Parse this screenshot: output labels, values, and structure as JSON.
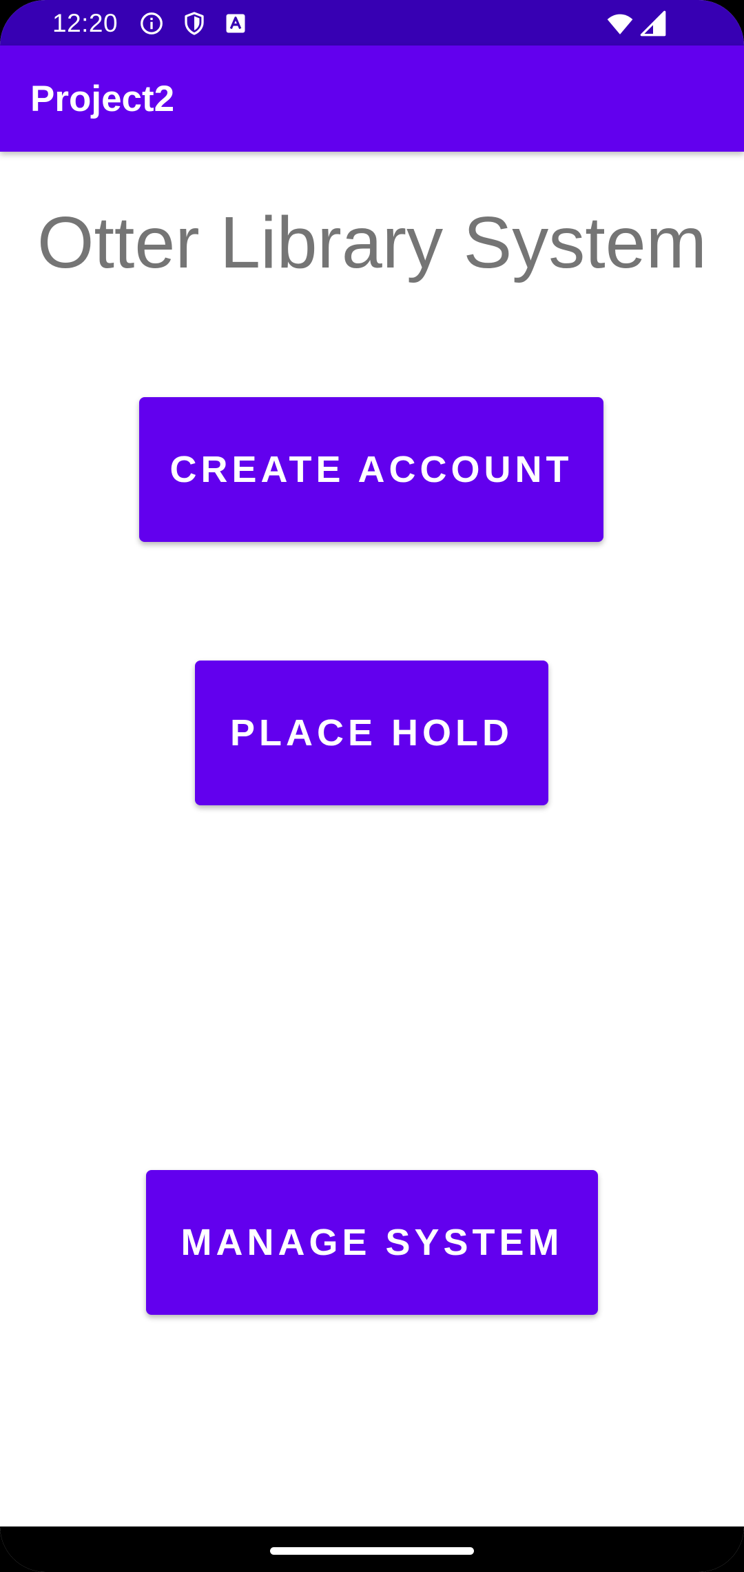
{
  "status_bar": {
    "time": "12:20",
    "icons": [
      "info-icon",
      "shield-icon",
      "font-icon",
      "wifi-icon",
      "cellular-signal-icon"
    ],
    "background": "#3700b3"
  },
  "app_bar": {
    "title": "Project2",
    "background": "#6200ee"
  },
  "main": {
    "heading": "Otter Library System",
    "heading_color": "#757575",
    "buttons": {
      "create_account": "CREATE ACCOUNT",
      "place_hold": "PLACE HOLD",
      "manage_system": "MANAGE SYSTEM"
    },
    "button_color": "#6200ee"
  },
  "nav_bar": {
    "background": "#000000",
    "handle": "gesture-handle"
  }
}
